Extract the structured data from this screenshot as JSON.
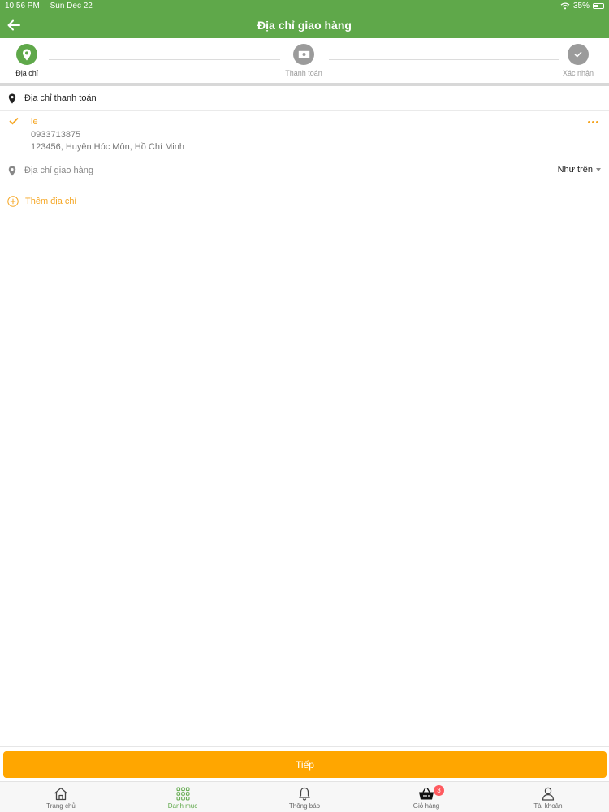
{
  "status_bar": {
    "time": "10:56 PM",
    "date": "Sun Dec 22",
    "battery": "35%"
  },
  "app_bar": {
    "title": "Địa chỉ giao hàng"
  },
  "steps": [
    {
      "label": "Địa chỉ",
      "state": "active"
    },
    {
      "label": "Thanh toán",
      "state": "inactive"
    },
    {
      "label": "Xác nhận",
      "state": "inactive"
    }
  ],
  "billing": {
    "label": "Địa chỉ thanh toán",
    "address": {
      "name": "le",
      "phone": "0933713875",
      "address": "123456, Huyện Hóc Môn, Hồ Chí Minh"
    }
  },
  "shipping": {
    "label": "Địa chỉ giao hàng",
    "selected": "Như trên"
  },
  "add_address": {
    "label": "Thêm địa chỉ"
  },
  "cta": {
    "label": "Tiếp"
  },
  "tabs": [
    {
      "label": "Trang chủ",
      "icon": "home-icon"
    },
    {
      "label": "Danh mục",
      "icon": "grid-icon",
      "active": true
    },
    {
      "label": "Thông báo",
      "icon": "bell-icon"
    },
    {
      "label": "Giỏ hàng",
      "icon": "basket-icon",
      "badge": "3"
    },
    {
      "label": "Tài khoản",
      "icon": "user-icon"
    }
  ],
  "colors": {
    "primary": "#5fa84a",
    "accent": "#ffa600",
    "accent_text": "#f5a623",
    "badge": "#ff5a5f"
  }
}
